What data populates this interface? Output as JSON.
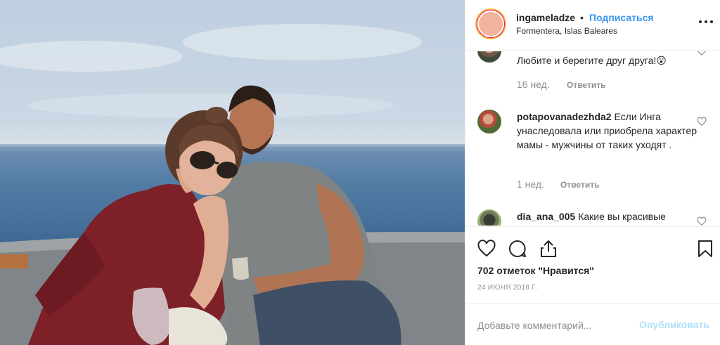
{
  "post": {
    "username": "ingameladze",
    "separator": "•",
    "follow_label": "Подписаться",
    "location": "Formentera, Islas Baleares"
  },
  "comments": [
    {
      "username": "",
      "text": "Любите и берегите друг друга!😲",
      "time": "16 нед.",
      "reply_label": "Ответить"
    },
    {
      "username": "potapovanadezhda2",
      "text": "Если Инга унаследовала или приобрела характер мамы - мужчины от таких уходят .",
      "time": "1 нед.",
      "reply_label": "Ответить"
    },
    {
      "username": "dia_ana_005",
      "text": "Какие вы красивые"
    }
  ],
  "actions": {
    "icons": [
      "heart-icon",
      "comment-icon",
      "share-icon",
      "bookmark-icon"
    ],
    "likes_text": "702 отметок \"Нравится\"",
    "date": "24 ИЮНЯ 2018 Г."
  },
  "comment_box": {
    "placeholder": "Добавьте комментарий...",
    "publish_label": "Опубликовать"
  },
  "colors": {
    "link": "#3897f0",
    "muted": "#8e8e8e",
    "publish_disabled": "#b2dffc",
    "border": "#efefef"
  }
}
